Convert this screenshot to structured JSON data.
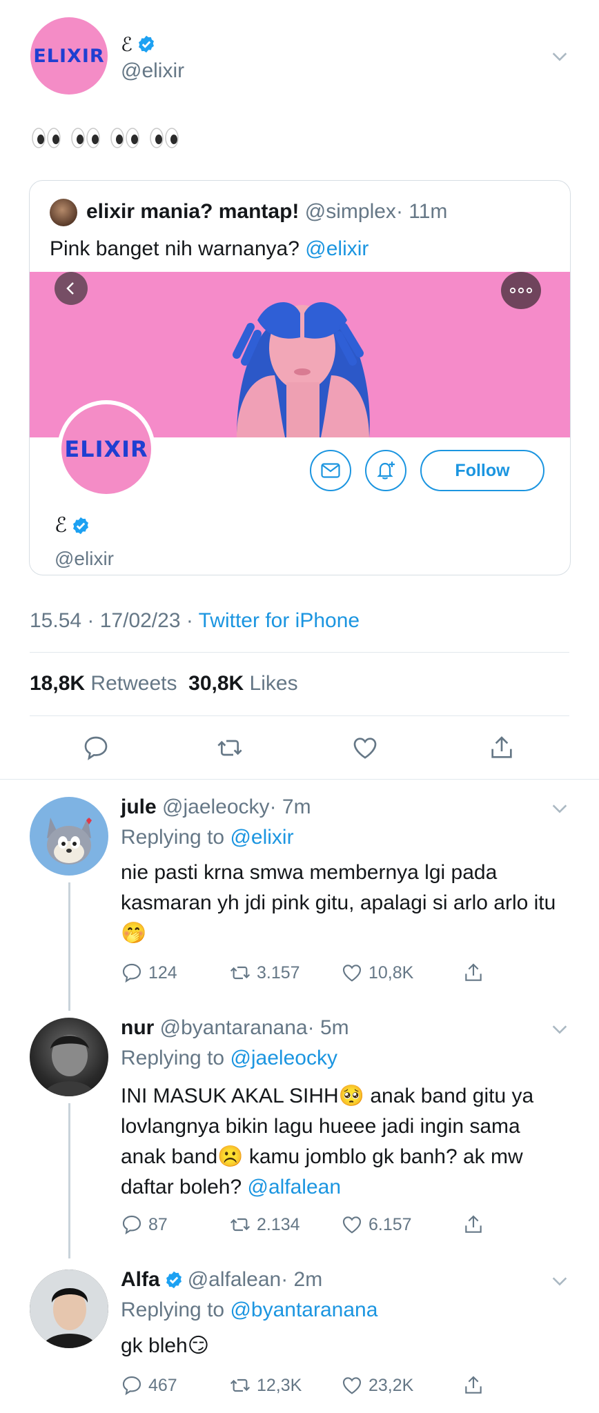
{
  "main_tweet": {
    "display_name": "ℰ",
    "handle": "@elixir",
    "avatar_text": "ELIXIR",
    "body": "👀👀👀👀",
    "timestamp": "15.54 · 17/02/23 · ",
    "source": "Twitter for iPhone",
    "retweets_count": "18,8K",
    "retweets_label": "Retweets",
    "likes_count": "30,8K",
    "likes_label": "Likes"
  },
  "quoted_tweet": {
    "display_name": "elixir mania? mantap!",
    "handle": "@simplex",
    "time": "· 11m",
    "text": "Pink banget nih warnanya? ",
    "mention": "@elixir",
    "profile_avatar_text": "ELIXIR",
    "profile_name": "ℰ",
    "profile_handle": "@elixir",
    "follow_label": "Follow"
  },
  "replies": [
    {
      "name": "jule",
      "handle": "@jaeleocky",
      "time": "· 7m",
      "replying_label": "Replying to ",
      "replying_to": "@elixir",
      "text": "nie pasti krna smwa membernya lgi pada kasmaran yh jdi pink gitu, apalagi si arlo arlo itu🤭",
      "replies": "124",
      "retweets": "3.157",
      "likes": "10,8K"
    },
    {
      "name": "nur",
      "handle": "@byantaranana",
      "time": "· 5m",
      "replying_label": "Replying to ",
      "replying_to": "@jaeleocky",
      "text": "INI MASUK AKAL SIHH🥺 anak band gitu ya lovlangnya bikin lagu hueee jadi ingin sama anak band☹️ kamu jomblo gk banh? ak mw daftar boleh? ",
      "mention": "@alfalean",
      "replies": "87",
      "retweets": "2.134",
      "likes": "6.157"
    },
    {
      "name": "Alfa",
      "handle": "@alfalean",
      "time": "· 2m",
      "replying_label": "Replying to ",
      "replying_to": "@byantaranana",
      "text": "gk bleh😏",
      "replies": "467",
      "retweets": "12,3K",
      "likes": "23,2K"
    }
  ],
  "colors": {
    "accent": "#1b95e0",
    "avatar_pink": "#f48cc6",
    "logo_blue": "#1f3fd1",
    "grey_text": "#657786"
  }
}
